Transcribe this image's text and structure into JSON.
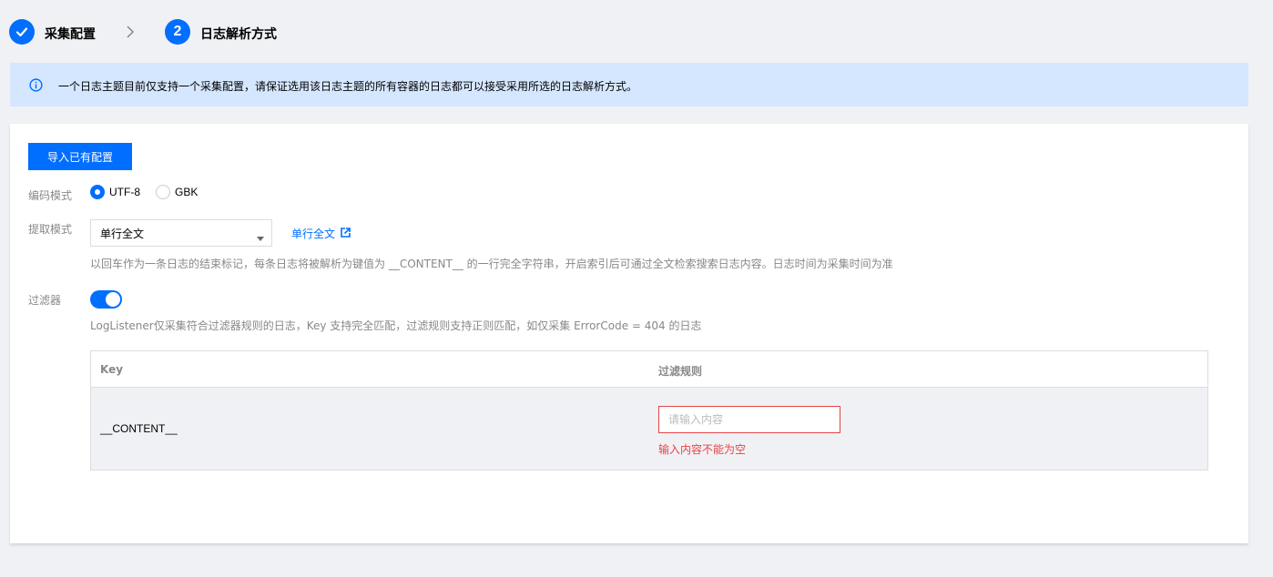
{
  "steps": [
    {
      "label": "采集配置",
      "state": "done"
    },
    {
      "label": "日志解析方式",
      "number": "2",
      "state": "active"
    }
  ],
  "alert": {
    "icon": "info-icon",
    "text": "一个日志主题目前仅支持一个采集配置，请保证选用该日志主题的所有容器的日志都可以接受采用所选的日志解析方式。"
  },
  "form": {
    "import_button": "导入已有配置",
    "encoding": {
      "label": "编码模式",
      "options": [
        "UTF-8",
        "GBK"
      ],
      "selected": "UTF-8"
    },
    "extract": {
      "label": "提取模式",
      "selected": "单行全文",
      "link_text": "单行全文",
      "help": "以回车作为一条日志的结束标记，每条日志将被解析为键值为 __CONTENT__ 的一行完全字符串，开启索引后可通过全文检索搜索日志内容。日志时间为采集时间为准"
    },
    "filter": {
      "label": "过滤器",
      "enabled": true,
      "help": "LogListener仅采集符合过滤器规则的日志，Key 支持完全匹配，过滤规则支持正则匹配，如仅采集 ErrorCode = 404 的日志"
    }
  },
  "table": {
    "headers": [
      "Key",
      "过滤规则"
    ],
    "rows": [
      {
        "key": "__CONTENT__",
        "rule_value": "",
        "rule_placeholder": "请输入内容",
        "error": "输入内容不能为空"
      }
    ]
  },
  "colors": {
    "primary": "#006eff",
    "alert_bg": "#d5e7ff",
    "error": "#e54545",
    "page_bg": "#f0f1f5"
  }
}
